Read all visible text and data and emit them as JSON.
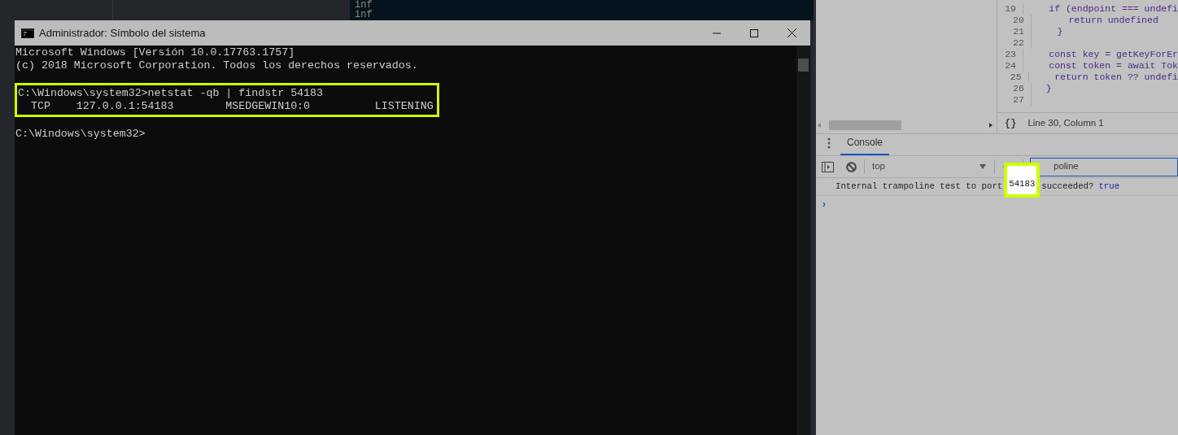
{
  "background_editor": {
    "lines": [
      "inf",
      "inf"
    ]
  },
  "cmd_window": {
    "title": "Administrador: Símbolo del sistema",
    "blocks": [
      {
        "highlighted": false,
        "lines": [
          "Microsoft Windows [Versión 10.0.17763.1757]",
          "(c) 2018 Microsoft Corporation. Todos los derechos reservados."
        ]
      },
      {
        "highlighted": true,
        "lines": [
          "C:\\Windows\\system32>netstat -qb | findstr 54183",
          "  TCP    127.0.0.1:54183        MSEDGEWIN10:0          LISTENING"
        ]
      },
      {
        "highlighted": false,
        "lines": [
          "C:\\Windows\\system32>"
        ]
      }
    ]
  },
  "devtools": {
    "code_lines": [
      {
        "number": "19",
        "text": "    if (endpoint === undefi"
      },
      {
        "number": "20",
        "text": "      return undefined"
      },
      {
        "number": "21",
        "text": "    }"
      },
      {
        "number": "22"
      },
      {
        "number": "23",
        "text": "    const key = getKeyForEr"
      },
      {
        "number": "24",
        "text": "    const token = await Tok"
      },
      {
        "number": "25",
        "text": "    return token ?? undefi"
      },
      {
        "number": "26",
        "text": "  }"
      },
      {
        "number": "27"
      }
    ],
    "format_button": "{}",
    "status": "Line 30, Column 1",
    "tabs": [
      {
        "label": "Console",
        "selected": true
      }
    ],
    "context": "top",
    "filter": "poline",
    "prompt": "›",
    "messages": [
      {
        "text": "Internal trampoline test to port",
        "highlight": "54183",
        "rest": "succeeded?",
        "value": "true"
      }
    ]
  }
}
